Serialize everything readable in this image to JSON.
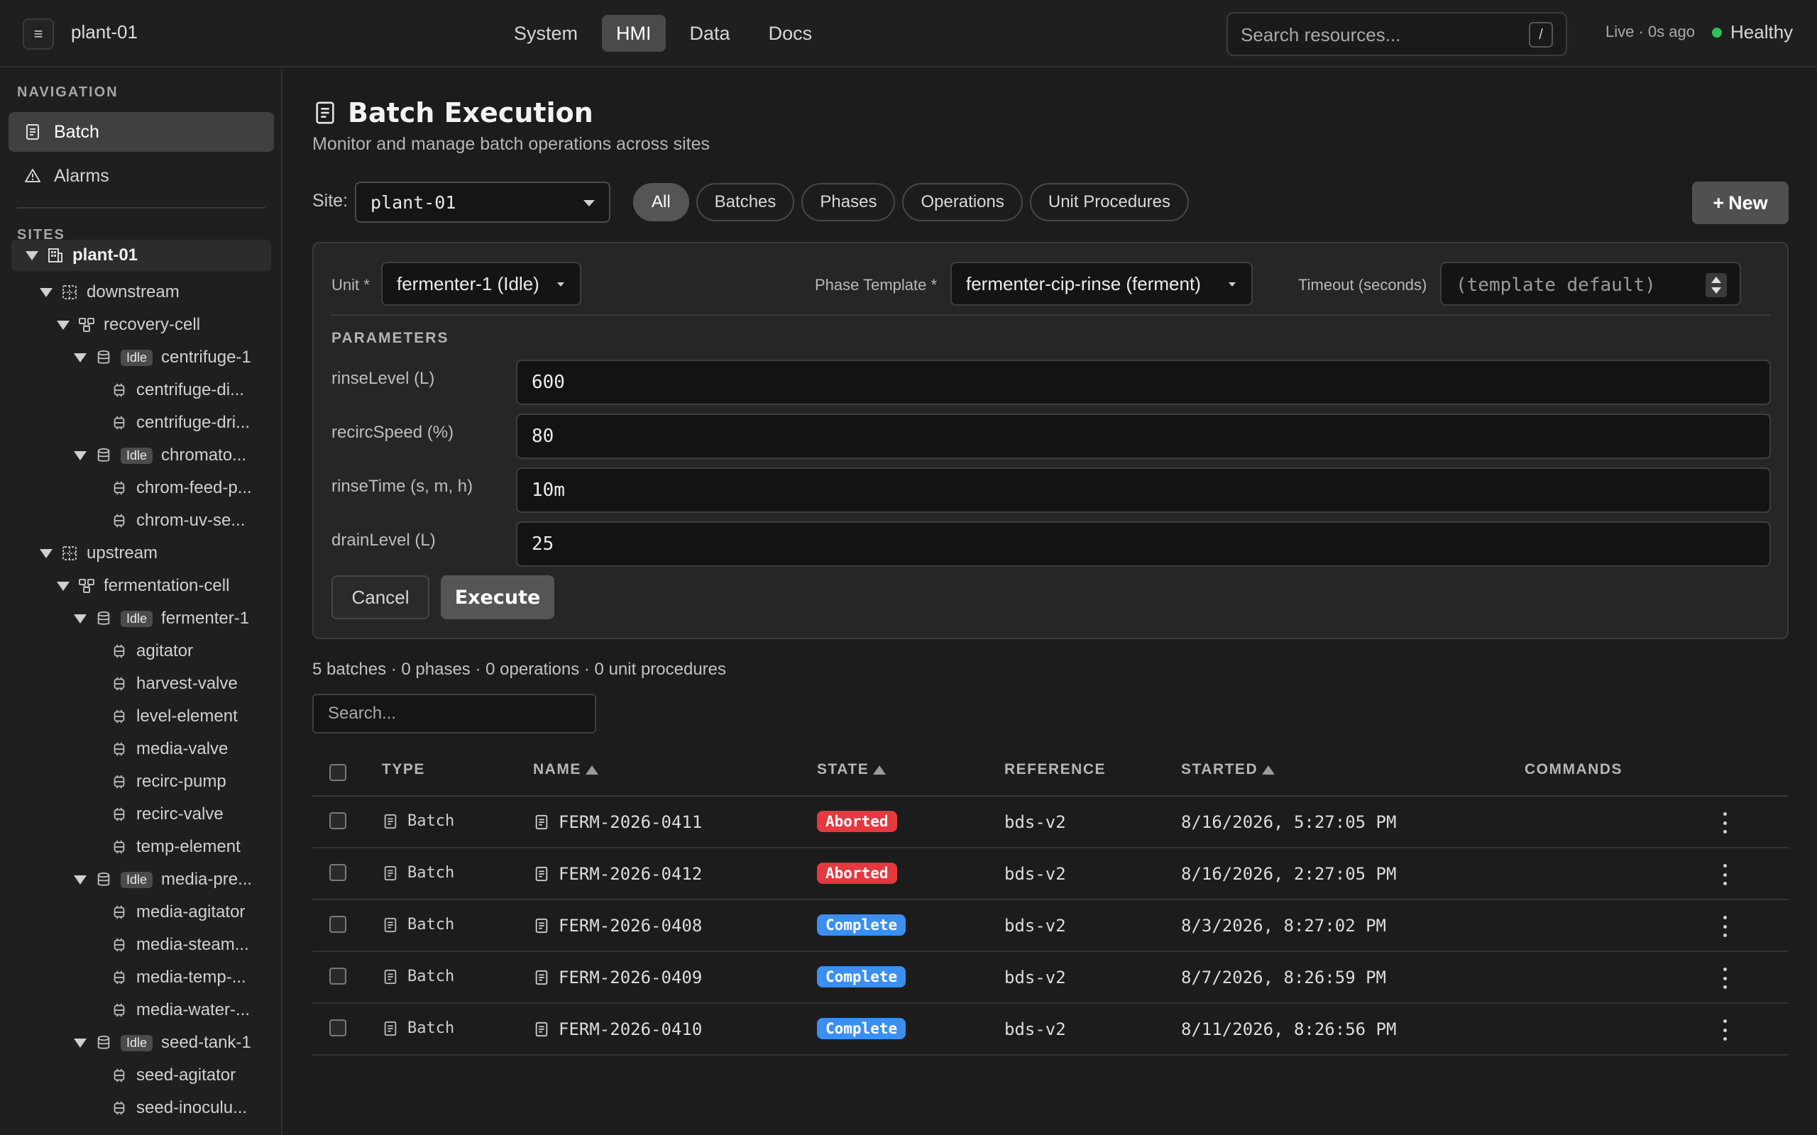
{
  "header": {
    "site_name": "plant-01",
    "tabs": [
      {
        "label": "System",
        "active": false
      },
      {
        "label": "HMI",
        "active": true
      },
      {
        "label": "Data",
        "active": false
      },
      {
        "label": "Docs",
        "active": false
      }
    ],
    "search_placeholder": "Search resources...",
    "search_shortcut": "/",
    "live_status": "Live · 0s ago",
    "health_label": "Healthy",
    "health_color": "#2fbf5b"
  },
  "sidebar": {
    "nav_heading": "NAVIGATION",
    "nav_items": [
      {
        "label": "Batch",
        "icon": "document-icon",
        "active": true
      },
      {
        "label": "Alarms",
        "icon": "warning-icon",
        "active": false
      }
    ],
    "sites_heading": "SITES",
    "tree": [
      {
        "label": "plant-01",
        "kind": "site"
      },
      {
        "label": "downstream",
        "kind": "area"
      },
      {
        "label": "recovery-cell",
        "kind": "cell"
      },
      {
        "label": "centrifuge-1",
        "kind": "unit",
        "badge": "Idle"
      },
      {
        "label": "centrifuge-di...",
        "kind": "module"
      },
      {
        "label": "centrifuge-dri...",
        "kind": "module"
      },
      {
        "label": "chromato...",
        "kind": "unit",
        "badge": "Idle"
      },
      {
        "label": "chrom-feed-p...",
        "kind": "module"
      },
      {
        "label": "chrom-uv-se...",
        "kind": "module"
      },
      {
        "label": "upstream",
        "kind": "area"
      },
      {
        "label": "fermentation-cell",
        "kind": "cell"
      },
      {
        "label": "fermenter-1",
        "kind": "unit",
        "badge": "Idle"
      },
      {
        "label": "agitator",
        "kind": "module"
      },
      {
        "label": "harvest-valve",
        "kind": "module"
      },
      {
        "label": "level-element",
        "kind": "module"
      },
      {
        "label": "media-valve",
        "kind": "module"
      },
      {
        "label": "recirc-pump",
        "kind": "module"
      },
      {
        "label": "recirc-valve",
        "kind": "module"
      },
      {
        "label": "temp-element",
        "kind": "module"
      },
      {
        "label": "media-pre...",
        "kind": "unit",
        "badge": "Idle"
      },
      {
        "label": "media-agitator",
        "kind": "module"
      },
      {
        "label": "media-steam...",
        "kind": "module"
      },
      {
        "label": "media-temp-...",
        "kind": "module"
      },
      {
        "label": "media-water-...",
        "kind": "module"
      },
      {
        "label": "seed-tank-1",
        "kind": "unit",
        "badge": "Idle"
      },
      {
        "label": "seed-agitator",
        "kind": "module"
      },
      {
        "label": "seed-inoculu...",
        "kind": "module"
      }
    ]
  },
  "main": {
    "title": "Batch Execution",
    "subtitle": "Monitor and manage batch operations across sites",
    "site_label": "Site:",
    "site_value": "plant-01",
    "filters": [
      {
        "label": "All",
        "active": true
      },
      {
        "label": "Batches",
        "active": false
      },
      {
        "label": "Phases",
        "active": false
      },
      {
        "label": "Operations",
        "active": false
      },
      {
        "label": "Unit Procedures",
        "active": false
      }
    ],
    "new_button": {
      "plus": "+",
      "label": "New"
    },
    "form": {
      "unit_label": "Unit *",
      "unit_value": "fermenter-1 (Idle)",
      "phase_label": "Phase Template *",
      "phase_value": "fermenter-cip-rinse (ferment)",
      "timeout_label": "Timeout (seconds)",
      "timeout_placeholder": "(template default)",
      "params_heading": "PARAMETERS",
      "params": [
        {
          "label": "rinseLevel (L)",
          "value": "600"
        },
        {
          "label": "recircSpeed (%)",
          "value": "80"
        },
        {
          "label": "rinseTime (s, m, h)",
          "value": "10m"
        },
        {
          "label": "drainLevel (L)",
          "value": "25"
        }
      ],
      "cancel_label": "Cancel",
      "execute_label": "Execute"
    },
    "summary": "5 batches · 0 phases · 0 operations · 0 unit procedures",
    "table_search_placeholder": "Search...",
    "table": {
      "columns": {
        "type": "TYPE",
        "name": "NAME",
        "state": "STATE",
        "reference": "REFERENCE",
        "started": "STARTED",
        "commands": "COMMANDS"
      },
      "rows": [
        {
          "type": "Batch",
          "name": "FERM-2026-0411",
          "state": "Aborted",
          "state_color": "#e5383f",
          "reference": "bds-v2",
          "started": "8/16/2026, 5:27:05 PM"
        },
        {
          "type": "Batch",
          "name": "FERM-2026-0412",
          "state": "Aborted",
          "state_color": "#e5383f",
          "reference": "bds-v2",
          "started": "8/16/2026, 2:27:05 PM"
        },
        {
          "type": "Batch",
          "name": "FERM-2026-0408",
          "state": "Complete",
          "state_color": "#3b8ff0",
          "reference": "bds-v2",
          "started": "8/3/2026, 8:27:02 PM"
        },
        {
          "type": "Batch",
          "name": "FERM-2026-0409",
          "state": "Complete",
          "state_color": "#3b8ff0",
          "reference": "bds-v2",
          "started": "8/7/2026, 8:26:59 PM"
        },
        {
          "type": "Batch",
          "name": "FERM-2026-0410",
          "state": "Complete",
          "state_color": "#3b8ff0",
          "reference": "bds-v2",
          "started": "8/11/2026, 8:26:56 PM"
        }
      ]
    }
  }
}
